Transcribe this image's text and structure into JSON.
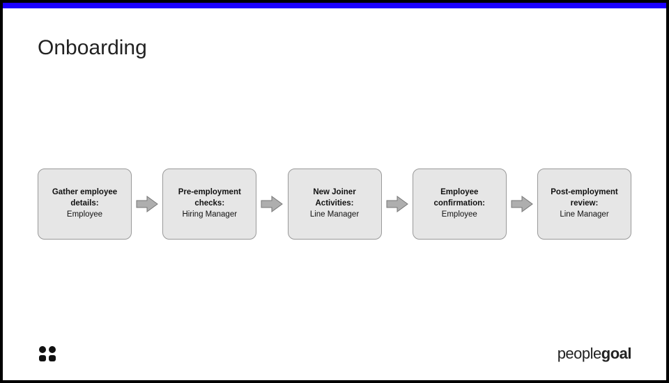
{
  "title": "Onboarding",
  "steps": [
    {
      "label": "Gather employee details",
      "role": "Employee"
    },
    {
      "label": "Pre-employment checks",
      "role": "Hiring Manager"
    },
    {
      "label": "New Joiner Activities",
      "role": "Line Manager"
    },
    {
      "label": "Employee confirmation",
      "role": "Employee"
    },
    {
      "label": "Post-employment review",
      "role": "Line Manager"
    }
  ],
  "brand": {
    "prefix": "people",
    "suffix": "goal"
  },
  "colors": {
    "accent": "#1b00ff",
    "box_fill": "#e6e6e6",
    "box_border": "#999",
    "arrow_fill": "#aeaeae",
    "arrow_border": "#777"
  }
}
